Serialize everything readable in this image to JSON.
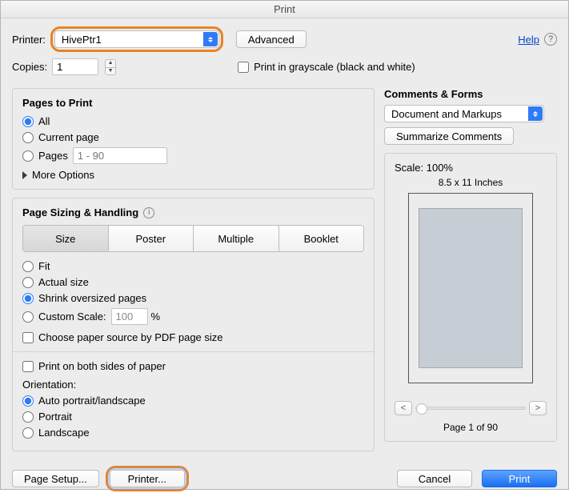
{
  "title": "Print",
  "top": {
    "printer_label": "Printer:",
    "printer_value": "HivePtr1",
    "advanced": "Advanced",
    "help": "Help",
    "copies_label": "Copies:",
    "copies_value": "1",
    "grayscale_label": "Print in grayscale (black and white)"
  },
  "pages": {
    "title": "Pages to Print",
    "all": "All",
    "current": "Current page",
    "pages_label": "Pages",
    "pages_placeholder": "1 - 90",
    "more": "More Options"
  },
  "sizing": {
    "title": "Page Sizing & Handling",
    "size": "Size",
    "poster": "Poster",
    "multiple": "Multiple",
    "booklet": "Booklet",
    "fit": "Fit",
    "actual": "Actual size",
    "shrink": "Shrink oversized pages",
    "custom_label": "Custom Scale:",
    "custom_value": "100",
    "custom_pct": "%",
    "choose_paper": "Choose paper source by PDF page size"
  },
  "duplex": {
    "label": "Print on both sides of paper"
  },
  "orientation": {
    "title": "Orientation:",
    "auto": "Auto portrait/landscape",
    "portrait": "Portrait",
    "landscape": "Landscape"
  },
  "comments": {
    "title": "Comments & Forms",
    "select_value": "Document and Markups",
    "summarize": "Summarize Comments"
  },
  "preview": {
    "scale_label": "Scale: 100%",
    "dims": "8.5 x 11 Inches",
    "page_count": "Page 1 of 90"
  },
  "bottom": {
    "page_setup": "Page Setup...",
    "printer": "Printer...",
    "cancel": "Cancel",
    "print": "Print"
  }
}
